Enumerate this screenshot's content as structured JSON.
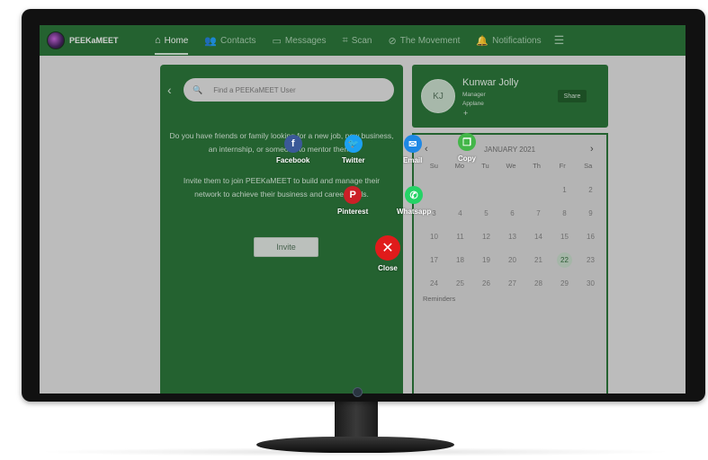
{
  "nav": {
    "logo_text": "PEEKaMEET",
    "items": [
      {
        "label": "Home",
        "icon": "⌂"
      },
      {
        "label": "Contacts",
        "icon": "👥"
      },
      {
        "label": "Messages",
        "icon": "▭"
      },
      {
        "label": "Scan",
        "icon": "⌗"
      },
      {
        "label": "The Movement",
        "icon": "⊘"
      },
      {
        "label": "Notifications",
        "icon": "🔔"
      }
    ],
    "menu_icon": "☰"
  },
  "invite": {
    "search_placeholder": "Find a PEEKaMEET User",
    "text_1": "Do you have friends or family looking for a new job, new business, an internship, or someone to mentor them?",
    "text_2": "Invite them to join PEEKaMEET to build and manage their network to achieve their business and career goals.",
    "button_label": "Invite"
  },
  "profile": {
    "initials": "KJ",
    "name": "Kunwar Jolly",
    "role": "Manager",
    "company": "Applane",
    "add": "+",
    "share_label": "Share"
  },
  "calendar": {
    "month": "JANUARY 2021",
    "prev": "‹",
    "next": "›",
    "weekdays": [
      "Su",
      "Mo",
      "Tu",
      "We",
      "Th",
      "Fr",
      "Sa"
    ],
    "days": [
      "",
      "",
      "",
      "",
      "",
      "1",
      "2",
      "3",
      "4",
      "5",
      "6",
      "7",
      "8",
      "9",
      "10",
      "11",
      "12",
      "13",
      "14",
      "15",
      "16",
      "17",
      "18",
      "19",
      "20",
      "21",
      "22",
      "23",
      "24",
      "25",
      "26",
      "27",
      "28",
      "29",
      "30"
    ],
    "selected": "22",
    "reminders": "Reminders"
  },
  "share": {
    "facebook": {
      "label": "Facebook",
      "glyph": "f",
      "color": "#3b5998"
    },
    "twitter": {
      "label": "Twitter",
      "glyph": "🐦",
      "color": "#1da1f2"
    },
    "email": {
      "label": "Email",
      "glyph": "✉",
      "color": "#1e88e5"
    },
    "copy": {
      "label": "Copy",
      "glyph": "❐",
      "color": "#43b649"
    },
    "pinterest": {
      "label": "Pinterest",
      "glyph": "P",
      "color": "#cb2027"
    },
    "whatsapp": {
      "label": "Whatsapp",
      "glyph": "✆",
      "color": "#25d366"
    },
    "close": {
      "label": "Close",
      "glyph": "✕",
      "color": "#e01b1b"
    }
  }
}
